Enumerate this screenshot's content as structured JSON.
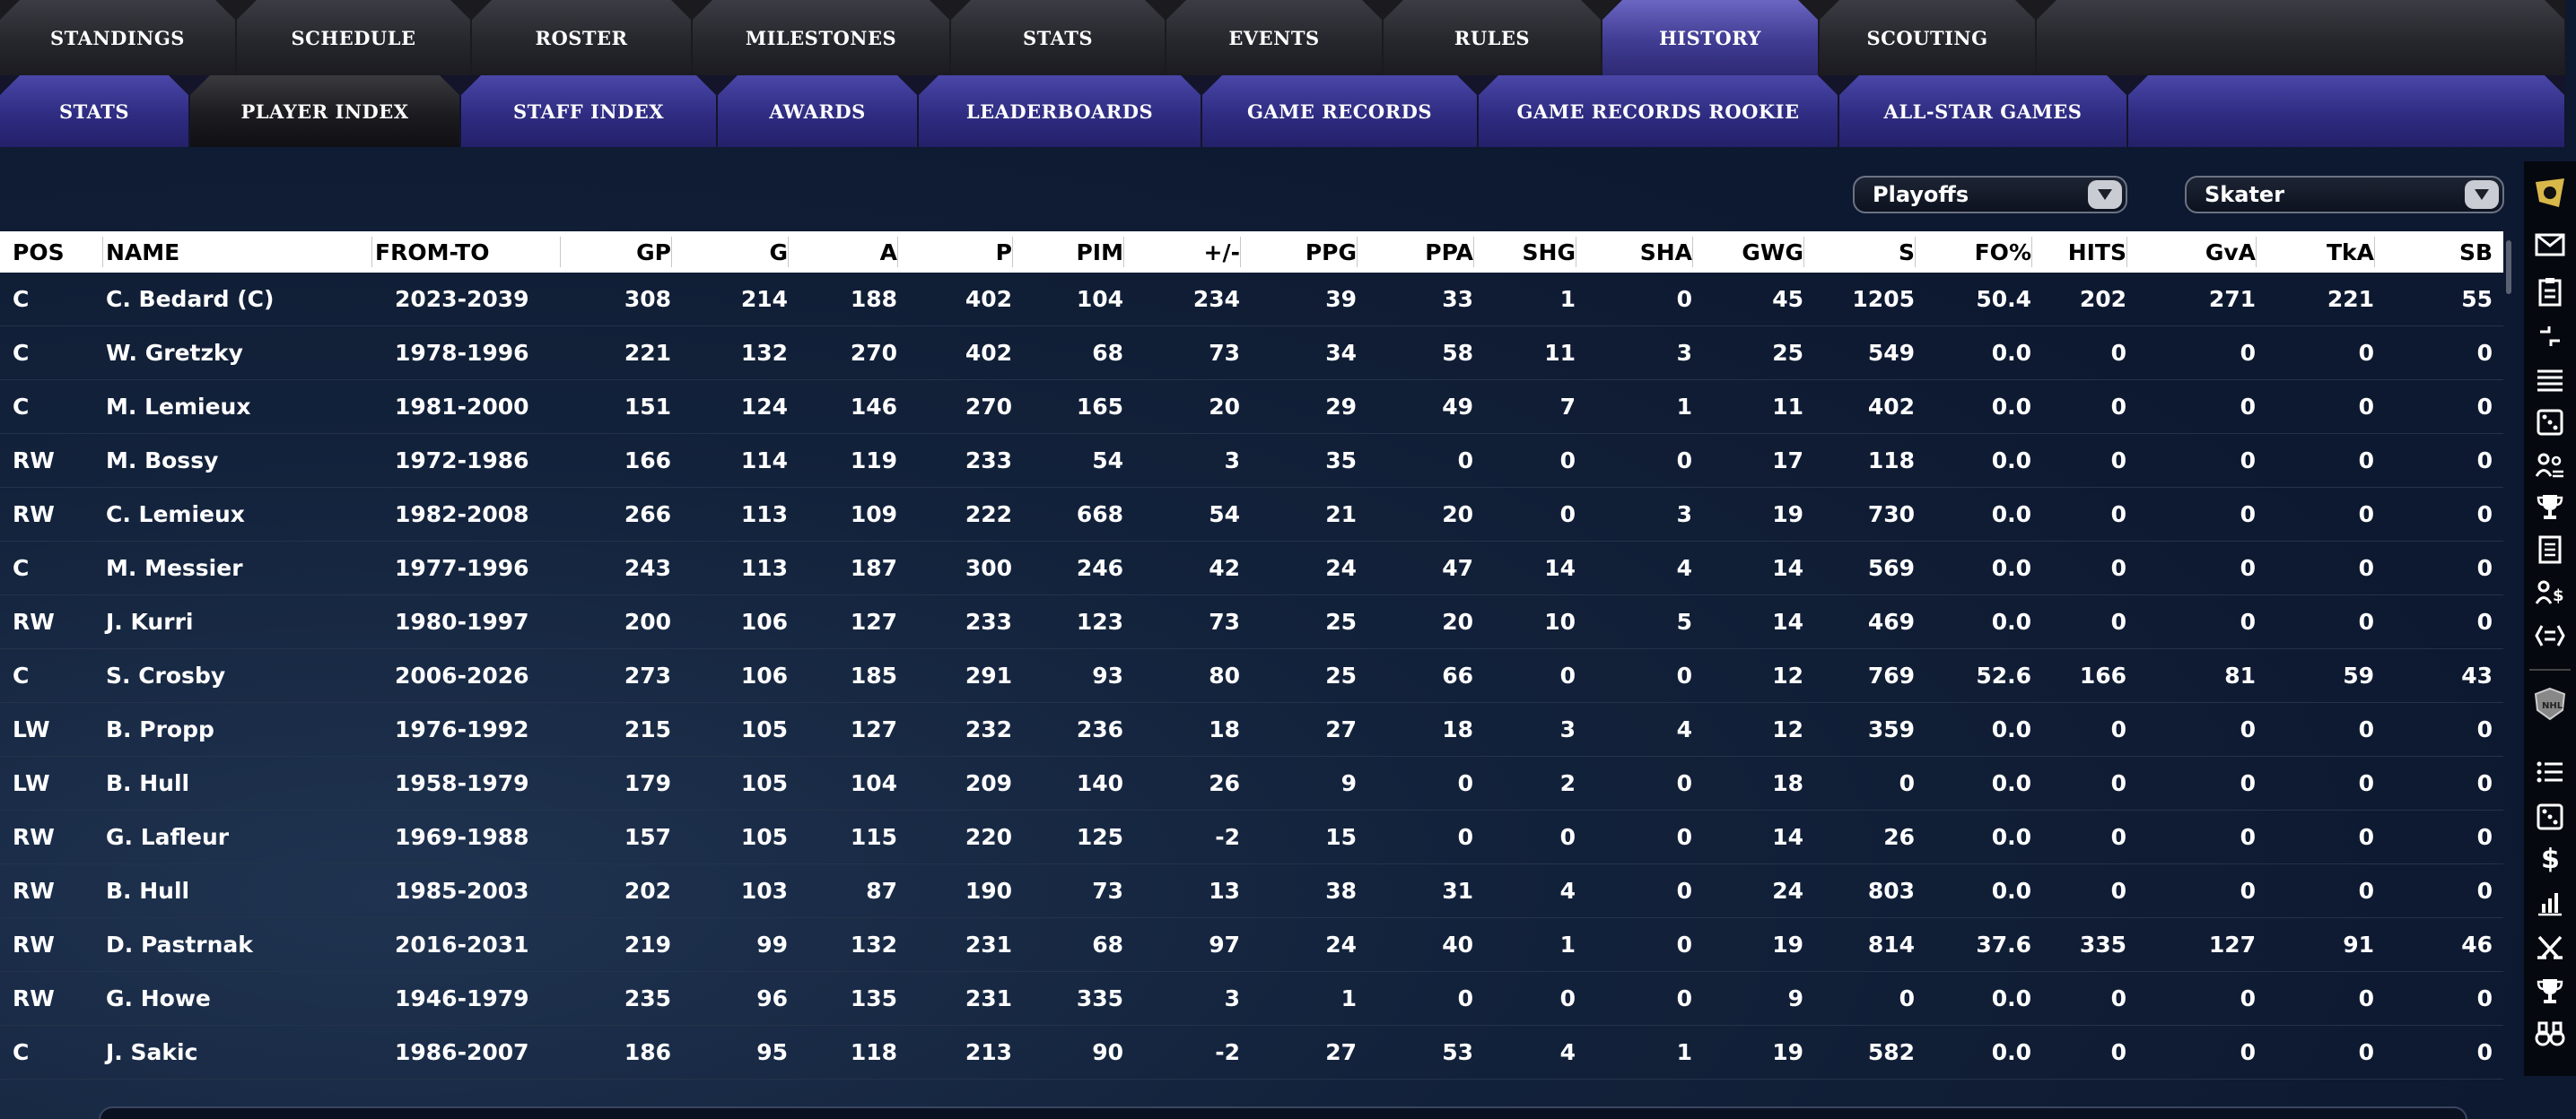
{
  "tabs_primary": [
    {
      "label": "STANDINGS",
      "active": false
    },
    {
      "label": "SCHEDULE",
      "active": false
    },
    {
      "label": "ROSTER",
      "active": false
    },
    {
      "label": "MILESTONES",
      "active": false
    },
    {
      "label": "STATS",
      "active": false
    },
    {
      "label": "EVENTS",
      "active": false
    },
    {
      "label": "RULES",
      "active": false
    },
    {
      "label": "HISTORY",
      "active": true
    },
    {
      "label": "SCOUTING",
      "active": false
    }
  ],
  "tabs_secondary": [
    {
      "label": "STATS",
      "active": false
    },
    {
      "label": "PLAYER INDEX",
      "active": true
    },
    {
      "label": "STAFF INDEX",
      "active": false
    },
    {
      "label": "AWARDS",
      "active": false
    },
    {
      "label": "LEADERBOARDS",
      "active": false
    },
    {
      "label": "GAME RECORDS",
      "active": false
    },
    {
      "label": "GAME RECORDS ROOKIE",
      "active": false
    },
    {
      "label": "ALL-STAR GAMES",
      "active": false
    }
  ],
  "filters": {
    "season_type": "Playoffs",
    "player_type": "Skater"
  },
  "table": {
    "columns": [
      "POS",
      "NAME",
      "FROM-TO",
      "GP",
      "G",
      "A",
      "P",
      "PIM",
      "+/-",
      "PPG",
      "PPA",
      "SHG",
      "SHA",
      "GWG",
      "S",
      "FO%",
      "HITS",
      "GvA",
      "TkA",
      "SB"
    ],
    "rows": [
      [
        "C",
        "C. Bedard (C)",
        "2023-2039",
        "308",
        "214",
        "188",
        "402",
        "104",
        "234",
        "39",
        "33",
        "1",
        "0",
        "45",
        "1205",
        "50.4",
        "202",
        "271",
        "221",
        "55"
      ],
      [
        "C",
        "W. Gretzky",
        "1978-1996",
        "221",
        "132",
        "270",
        "402",
        "68",
        "73",
        "34",
        "58",
        "11",
        "3",
        "25",
        "549",
        "0.0",
        "0",
        "0",
        "0",
        "0"
      ],
      [
        "C",
        "M. Lemieux",
        "1981-2000",
        "151",
        "124",
        "146",
        "270",
        "165",
        "20",
        "29",
        "49",
        "7",
        "1",
        "11",
        "402",
        "0.0",
        "0",
        "0",
        "0",
        "0"
      ],
      [
        "RW",
        "M. Bossy",
        "1972-1986",
        "166",
        "114",
        "119",
        "233",
        "54",
        "3",
        "35",
        "0",
        "0",
        "0",
        "17",
        "118",
        "0.0",
        "0",
        "0",
        "0",
        "0"
      ],
      [
        "RW",
        "C. Lemieux",
        "1982-2008",
        "266",
        "113",
        "109",
        "222",
        "668",
        "54",
        "21",
        "20",
        "0",
        "3",
        "19",
        "730",
        "0.0",
        "0",
        "0",
        "0",
        "0"
      ],
      [
        "C",
        "M. Messier",
        "1977-1996",
        "243",
        "113",
        "187",
        "300",
        "246",
        "42",
        "24",
        "47",
        "14",
        "4",
        "14",
        "569",
        "0.0",
        "0",
        "0",
        "0",
        "0"
      ],
      [
        "RW",
        "J. Kurri",
        "1980-1997",
        "200",
        "106",
        "127",
        "233",
        "123",
        "73",
        "25",
        "20",
        "10",
        "5",
        "14",
        "469",
        "0.0",
        "0",
        "0",
        "0",
        "0"
      ],
      [
        "C",
        "S. Crosby",
        "2006-2026",
        "273",
        "106",
        "185",
        "291",
        "93",
        "80",
        "25",
        "66",
        "0",
        "0",
        "12",
        "769",
        "52.6",
        "166",
        "81",
        "59",
        "43"
      ],
      [
        "LW",
        "B. Propp",
        "1976-1992",
        "215",
        "105",
        "127",
        "232",
        "236",
        "18",
        "27",
        "18",
        "3",
        "4",
        "12",
        "359",
        "0.0",
        "0",
        "0",
        "0",
        "0"
      ],
      [
        "LW",
        "B. Hull",
        "1958-1979",
        "179",
        "105",
        "104",
        "209",
        "140",
        "26",
        "9",
        "0",
        "2",
        "0",
        "18",
        "0",
        "0.0",
        "0",
        "0",
        "0",
        "0"
      ],
      [
        "RW",
        "G. Lafleur",
        "1969-1988",
        "157",
        "105",
        "115",
        "220",
        "125",
        "-2",
        "15",
        "0",
        "0",
        "0",
        "14",
        "26",
        "0.0",
        "0",
        "0",
        "0",
        "0"
      ],
      [
        "RW",
        "B. Hull",
        "1985-2003",
        "202",
        "103",
        "87",
        "190",
        "73",
        "13",
        "38",
        "31",
        "4",
        "0",
        "24",
        "803",
        "0.0",
        "0",
        "0",
        "0",
        "0"
      ],
      [
        "RW",
        "D. Pastrnak",
        "2016-2031",
        "219",
        "99",
        "132",
        "231",
        "68",
        "97",
        "24",
        "40",
        "1",
        "0",
        "19",
        "814",
        "37.6",
        "335",
        "127",
        "91",
        "46"
      ],
      [
        "RW",
        "G. Howe",
        "1946-1979",
        "235",
        "96",
        "135",
        "231",
        "335",
        "3",
        "1",
        "0",
        "0",
        "0",
        "9",
        "0",
        "0.0",
        "0",
        "0",
        "0",
        "0"
      ],
      [
        "C",
        "J. Sakic",
        "1986-2007",
        "186",
        "95",
        "118",
        "213",
        "90",
        "-2",
        "27",
        "53",
        "4",
        "1",
        "19",
        "582",
        "0.0",
        "0",
        "0",
        "0",
        "0"
      ]
    ]
  },
  "sidebar_icons": [
    "team-logo-icon",
    "mail-icon",
    "clipboard-icon",
    "transfer-icon",
    "list-icon",
    "dice-icon",
    "staff-icon",
    "trophy-icon",
    "document-icon",
    "finance-staff-icon",
    "trade-icon",
    "league-logo-icon",
    "bullet-list-icon",
    "dice-icon",
    "dollar-icon",
    "bar-chart-icon",
    "crossed-sticks-icon",
    "trophy-icon",
    "binoculars-icon"
  ],
  "colors": {
    "active_tab": "#4a46a8",
    "header_bg": "#ffffff",
    "table_bg": "#0f1b30"
  }
}
